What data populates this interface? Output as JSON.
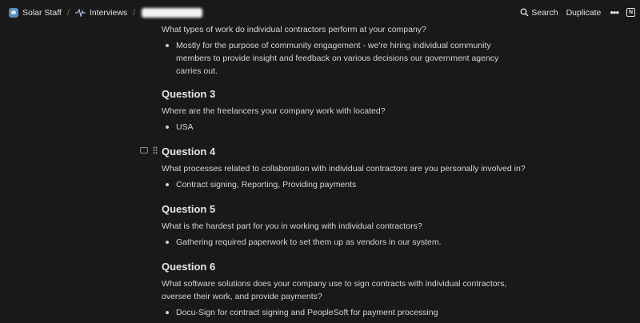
{
  "breadcrumb": {
    "workspace": "Solar Staff",
    "parent": "Interviews",
    "separator": "/"
  },
  "toolbar": {
    "search_label": "Search",
    "duplicate_label": "Duplicate",
    "more_label": "•••"
  },
  "icons": {
    "workspace": "workspace-icon",
    "interviews": "pulse-icon",
    "search": "search-icon",
    "more": "more-icon",
    "notion": "notion-icon",
    "comment": "comment-icon",
    "drag": "drag-handle-icon"
  },
  "document": {
    "q2_text": "What types of work do individual contractors perform at your company?",
    "q2_answer": "Mostly for the purpose of community engagement - we're hiring individual community members to provide insight and feedback on various decisions our government agency carries out.",
    "questions": [
      {
        "heading": "Question 3",
        "text": "Where are the freelancers your company work with located?",
        "answer": "USA"
      },
      {
        "heading": "Question 4",
        "text": "What processes related to collaboration with individual contractors are you personally involved in?",
        "answer": "Contract signing, Reporting, Providing payments"
      },
      {
        "heading": "Question 5",
        "text": "What is the hardest part for you in working with individual contractors?",
        "answer": "Gathering required paperwork to set them up as vendors in our system."
      },
      {
        "heading": "Question 6",
        "text": "What software solutions does your company use to sign contracts with individual contractors, oversee their work, and provide payments?",
        "answer": "Docu-Sign for contract signing and PeopleSoft for payment processing"
      }
    ]
  }
}
